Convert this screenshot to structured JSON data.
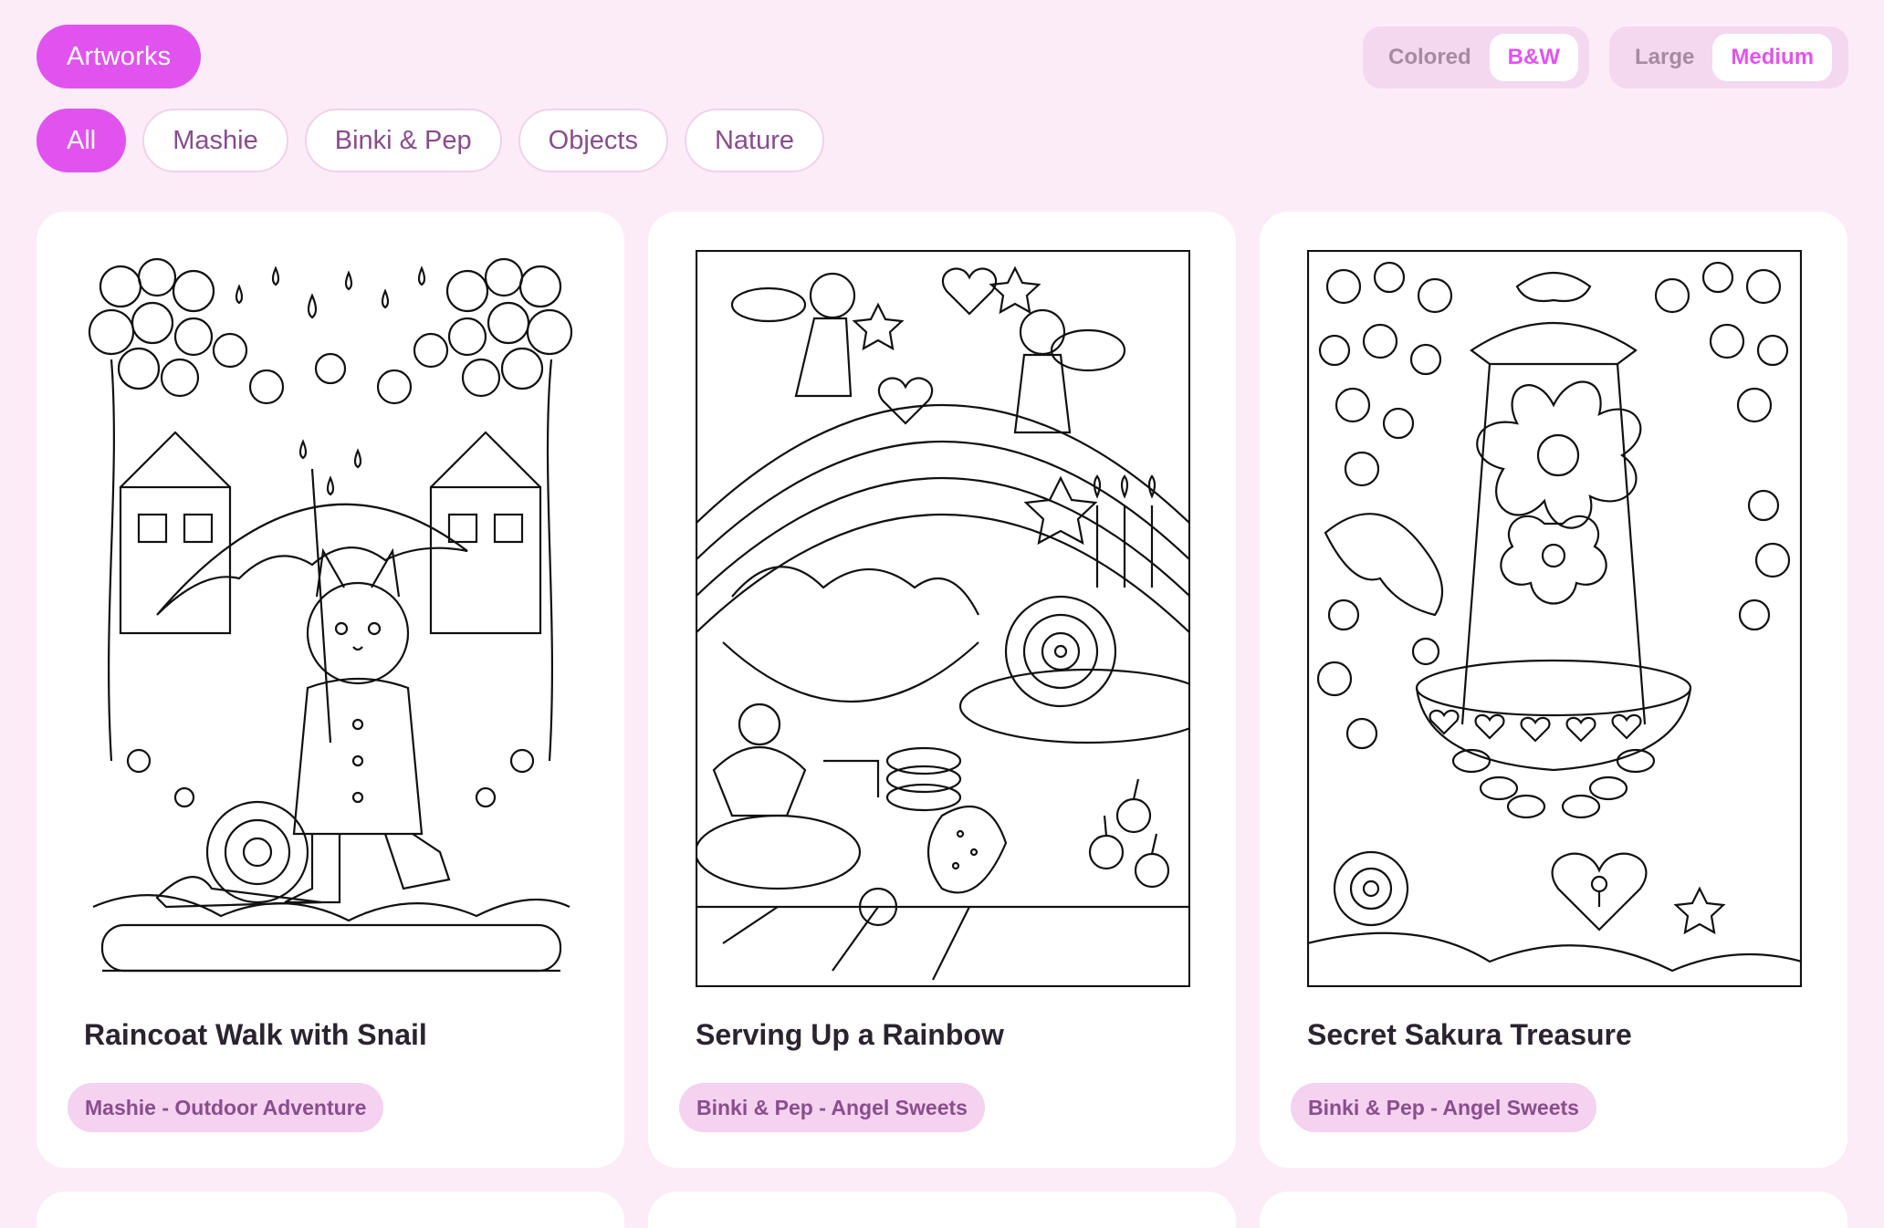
{
  "header": {
    "artworks_label": "Artworks"
  },
  "color_toggle": {
    "options": [
      "Colored",
      "B&W"
    ],
    "selected": "B&W"
  },
  "size_toggle": {
    "options": [
      "Large",
      "Medium"
    ],
    "selected": "Medium"
  },
  "filters": {
    "chips": [
      "All",
      "Mashie",
      "Binki & Pep",
      "Objects",
      "Nature"
    ],
    "selected": "All"
  },
  "cards": [
    {
      "title": "Raincoat Walk with Snail",
      "tag": "Mashie - Outdoor Adventure",
      "image": "cat-with-umbrella-line-art"
    },
    {
      "title": "Serving Up a Rainbow",
      "tag": "Binki & Pep - Angel Sweets",
      "image": "sweets-table-line-art"
    },
    {
      "title": "Secret Sakura Treasure",
      "tag": "Binki & Pep - Angel Sweets",
      "image": "sakura-lantern-line-art"
    }
  ],
  "colors": {
    "background": "#fcecf8",
    "accent": "#e153ef",
    "tag_bg": "#f4d2f0",
    "tag_text": "#8a4d8d"
  }
}
